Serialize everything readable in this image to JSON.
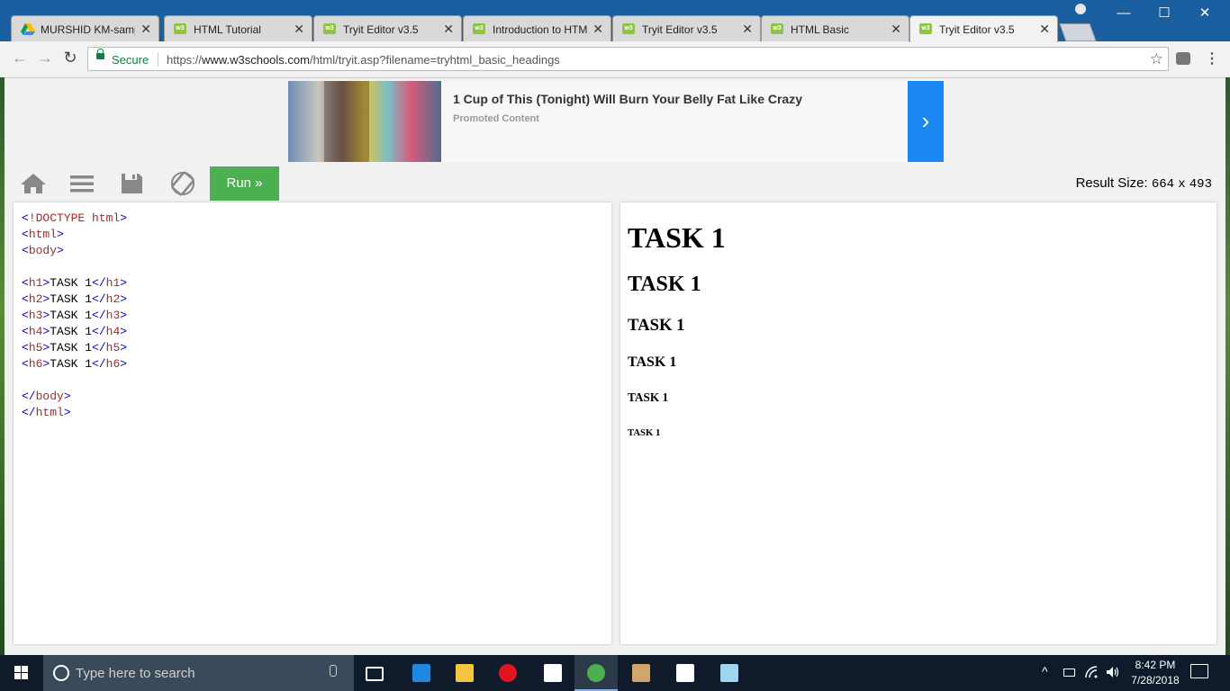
{
  "browser": {
    "tabs": [
      {
        "title": "MURSHID KM-samp",
        "favicon": "google-drive-icon",
        "active": false
      },
      {
        "title": "HTML Tutorial",
        "favicon": "w3schools-icon",
        "active": false
      },
      {
        "title": "Tryit Editor v3.5",
        "favicon": "w3schools-icon",
        "active": false
      },
      {
        "title": "Introduction to HTM",
        "favicon": "w3schools-icon",
        "active": false
      },
      {
        "title": "Tryit Editor v3.5",
        "favicon": "w3schools-icon",
        "active": false
      },
      {
        "title": "HTML Basic",
        "favicon": "w3schools-icon",
        "active": false
      },
      {
        "title": "Tryit Editor v3.5",
        "favicon": "w3schools-icon",
        "active": true
      }
    ],
    "favicon_text": "w3",
    "close_glyph": "✕",
    "window_buttons": {
      "minimize": "—",
      "maximize": "☐",
      "close": "✕"
    },
    "address": {
      "security_label": "Secure",
      "scheme": "https://",
      "domain": "www.w3schools.com",
      "path": "/html/tryit.asp?filename=tryhtml_basic_headings"
    },
    "nav": {
      "back": "←",
      "forward": "→",
      "reload": "↻",
      "star": "☆",
      "menu": "⋮"
    }
  },
  "ad": {
    "headline": "1 Cup of This (Tonight) Will Burn Your Belly Fat Like Crazy",
    "sponsor": "Promoted Content",
    "arrow": "›"
  },
  "tryit": {
    "run_label": "Run »",
    "result_size_label": "Result Size:",
    "result_width": "664",
    "result_x": "x",
    "result_height": "493",
    "icons": [
      "home-icon",
      "menu-icon",
      "save-icon",
      "rotate-icon"
    ]
  },
  "editor": {
    "lines": [
      "<!DOCTYPE html>",
      "<html>",
      "<body>",
      "",
      "<h1>TASK 1</h1>",
      "<h2>TASK 1</h2>",
      "<h3>TASK 1</h3>",
      "<h4>TASK 1</h4>",
      "<h5>TASK 1</h5>",
      "<h6>TASK 1</h6>",
      "",
      "</body>",
      "</html>"
    ]
  },
  "result": {
    "h1": "TASK 1",
    "h2": "TASK 1",
    "h3": "TASK 1",
    "h4": "TASK 1",
    "h5": "TASK 1",
    "h6": "TASK 1"
  },
  "taskbar": {
    "search_placeholder": "Type here to search",
    "apps": [
      {
        "name": "task-view",
        "color": "#ffffff"
      },
      {
        "name": "edge",
        "color": "#1e88e5"
      },
      {
        "name": "file-explorer",
        "color": "#f4c542"
      },
      {
        "name": "opera",
        "color": "#e0161f"
      },
      {
        "name": "notepad",
        "color": "#ffffff"
      },
      {
        "name": "chrome",
        "color": "#4caf50"
      },
      {
        "name": "snipping-tool",
        "color": "#d2a56b"
      },
      {
        "name": "slack",
        "color": "#ffffff"
      },
      {
        "name": "paint",
        "color": "#9fd5f0"
      }
    ],
    "tray_arrow": "^",
    "time": "8:42 PM",
    "date": "7/28/2018"
  }
}
